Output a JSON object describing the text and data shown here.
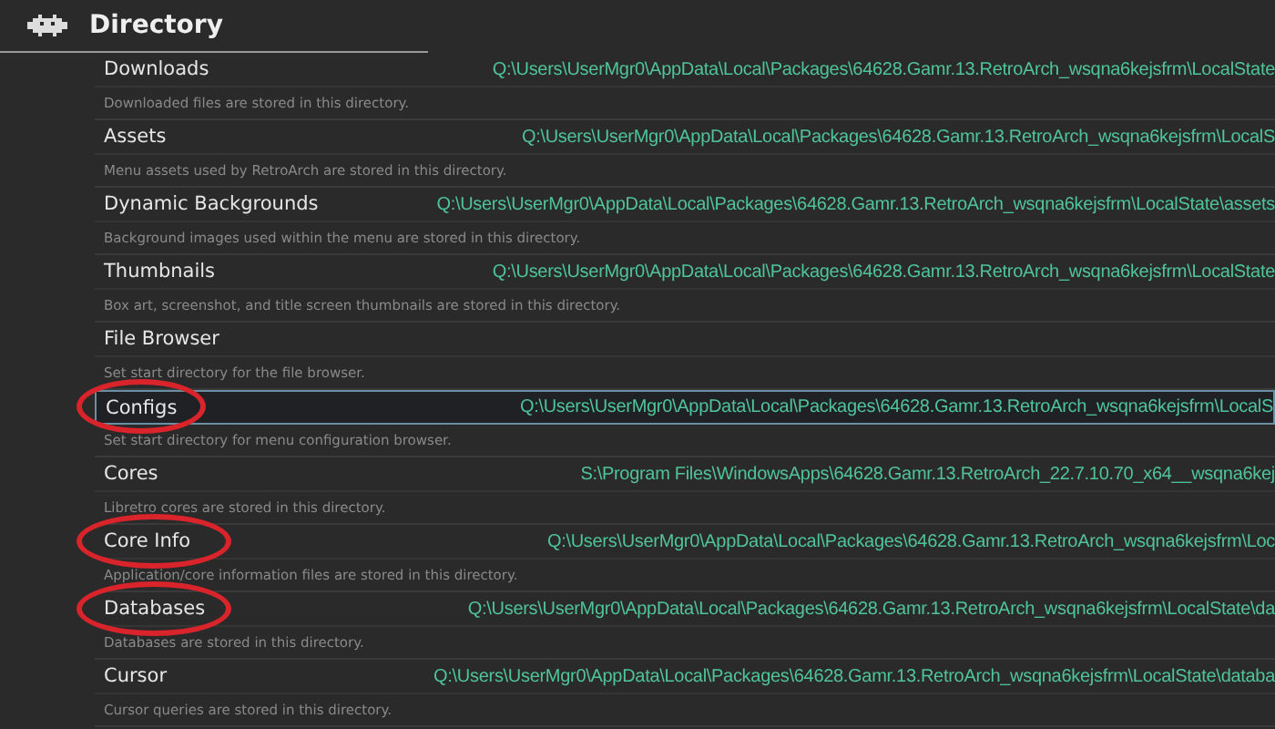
{
  "header": {
    "title": "Directory"
  },
  "settings": [
    {
      "name": "Downloads",
      "value": "Q:\\Users\\UserMgr0\\AppData\\Local\\Packages\\64628.Gamr.13.RetroArch_wsqna6kejsfrm\\LocalState",
      "description": "Downloaded files are stored in this directory.",
      "selected": false,
      "circled": false
    },
    {
      "name": "Assets",
      "value": "Q:\\Users\\UserMgr0\\AppData\\Local\\Packages\\64628.Gamr.13.RetroArch_wsqna6kejsfrm\\LocalS",
      "description": "Menu assets used by RetroArch are stored in this directory.",
      "selected": false,
      "circled": false
    },
    {
      "name": "Dynamic Backgrounds",
      "value": "Q:\\Users\\UserMgr0\\AppData\\Local\\Packages\\64628.Gamr.13.RetroArch_wsqna6kejsfrm\\LocalState\\assets",
      "description": "Background images used within the menu are stored in this directory.",
      "selected": false,
      "circled": false
    },
    {
      "name": "Thumbnails",
      "value": "Q:\\Users\\UserMgr0\\AppData\\Local\\Packages\\64628.Gamr.13.RetroArch_wsqna6kejsfrm\\LocalState",
      "description": "Box art, screenshot, and title screen thumbnails are stored in this directory.",
      "selected": false,
      "circled": false
    },
    {
      "name": "File Browser",
      "description": "Set start directory for the file browser.",
      "selected": false,
      "circled": false
    },
    {
      "name": "Configs",
      "value": "Q:\\Users\\UserMgr0\\AppData\\Local\\Packages\\64628.Gamr.13.RetroArch_wsqna6kejsfrm\\LocalS",
      "description": "Set start directory for menu configuration browser.",
      "selected": true,
      "circled": true
    },
    {
      "name": "Cores",
      "value": "S:\\Program Files\\WindowsApps\\64628.Gamr.13.RetroArch_22.7.10.70_x64__wsqna6kej",
      "description": "Libretro cores are stored in this directory.",
      "selected": false,
      "circled": false
    },
    {
      "name": "Core Info",
      "value": "Q:\\Users\\UserMgr0\\AppData\\Local\\Packages\\64628.Gamr.13.RetroArch_wsqna6kejsfrm\\Loc",
      "description": "Application/core information files are stored in this directory.",
      "selected": false,
      "circled": true
    },
    {
      "name": "Databases",
      "value": "Q:\\Users\\UserMgr0\\AppData\\Local\\Packages\\64628.Gamr.13.RetroArch_wsqna6kejsfrm\\LocalState\\da",
      "description": "Databases are stored in this directory.",
      "selected": false,
      "circled": true
    },
    {
      "name": "Cursor",
      "value": "Q:\\Users\\UserMgr0\\AppData\\Local\\Packages\\64628.Gamr.13.RetroArch_wsqna6kejsfrm\\LocalState\\databa",
      "description": "Cursor queries are stored in this directory.",
      "selected": false,
      "circled": false
    }
  ]
}
